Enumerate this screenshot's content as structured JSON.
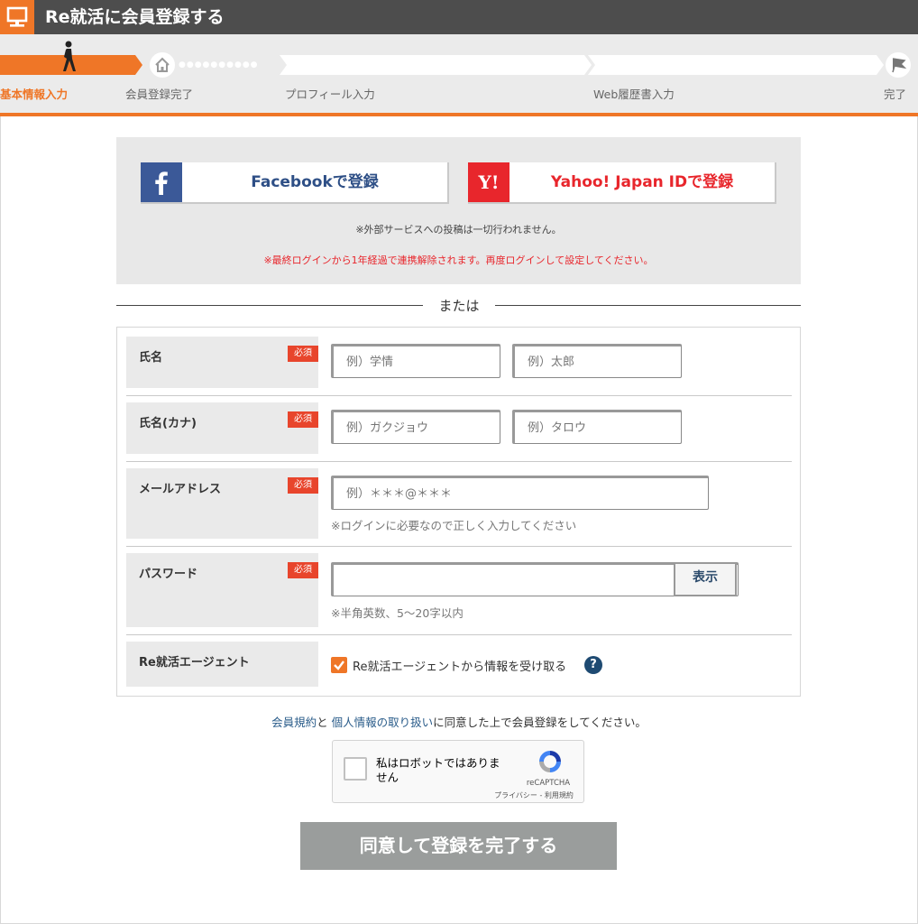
{
  "header": {
    "title": "Re就活に会員登録する",
    "icon": "monitor-icon"
  },
  "progress": {
    "steps": [
      {
        "label": "基本情報入力",
        "icon": "walking-person-icon"
      },
      {
        "label": "会員登録完了",
        "icon": "home-icon"
      },
      {
        "label": "プロフィール入力"
      },
      {
        "label": "Web履歴書入力"
      },
      {
        "label": "完了",
        "icon": "flag-icon"
      }
    ],
    "active_step": 1
  },
  "sns": {
    "facebook_label": "Facebookで登録",
    "yahoo_label": "Yahoo! Japan IDで登録",
    "yahoo_logo_text": "Y!",
    "note": "※外部サービスへの投稿は一切行われません。",
    "warning": "※最終ログインから1年経過で連携解除されます。再度ログインして設定してください。"
  },
  "divider": {
    "or_text": "または"
  },
  "form": {
    "required_badge": "必須",
    "name": {
      "label": "氏名",
      "last_placeholder": "例）学情",
      "first_placeholder": "例）太郎"
    },
    "kana": {
      "label": "氏名(カナ)",
      "last_placeholder": "例）ガクジョウ",
      "first_placeholder": "例）タロウ"
    },
    "email": {
      "label": "メールアドレス",
      "placeholder": "例）＊＊＊@＊＊＊",
      "hint": "※ログインに必要なので正しく入力してください"
    },
    "password": {
      "label": "パスワード",
      "show_button": "表示",
      "hint": "※半角英数、5〜20字以内"
    },
    "agent": {
      "label": "Re就活エージェント",
      "checkbox_label": "Re就活エージェントから情報を受け取る",
      "checked": true,
      "help": "?"
    }
  },
  "agreement": {
    "terms_link": "会員規約",
    "and": "と ",
    "privacy_link": "個人情報の取り扱い",
    "rest": "に同意した上で会員登録をしてください。"
  },
  "recaptcha": {
    "label": "私はロボットではありません",
    "brand": "reCAPTCHA",
    "links": "プライバシー - 利用規約"
  },
  "submit_label": "同意して登録を完了する",
  "colors": {
    "accent": "#ef7627",
    "header": "#4d4d4d",
    "facebook": "#3b5998",
    "yahoo": "#e8262c",
    "required": "#e8452c"
  }
}
